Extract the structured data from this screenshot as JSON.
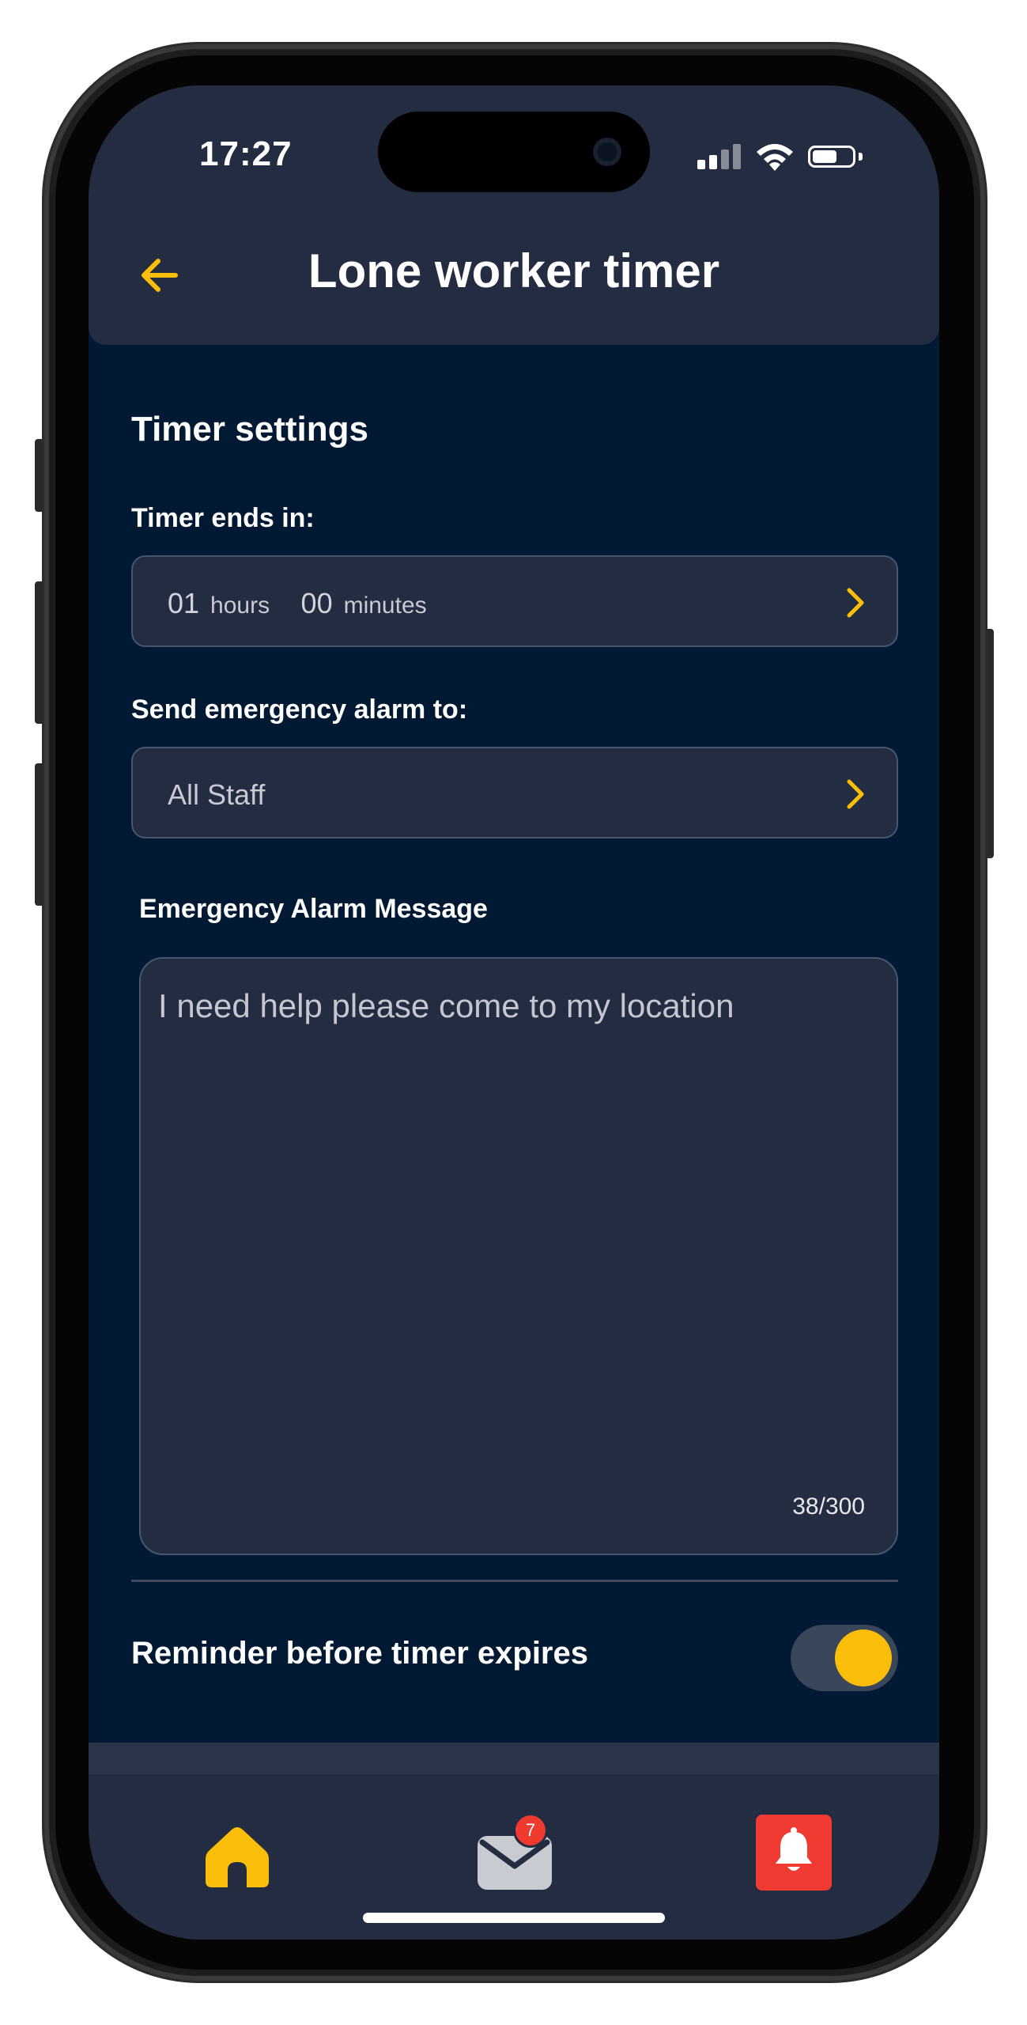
{
  "status_bar": {
    "time": "17:27"
  },
  "header": {
    "title": "Lone worker timer"
  },
  "settings": {
    "section_title": "Timer settings",
    "timer": {
      "label": "Timer ends in:",
      "hours_value": "01",
      "hours_unit": "hours",
      "minutes_value": "00",
      "minutes_unit": "minutes"
    },
    "recipient": {
      "label": "Send emergency alarm to:",
      "value": "All Staff"
    },
    "message": {
      "label": "Emergency Alarm Message",
      "text": "I need help please come to my location",
      "count": "38/300"
    },
    "reminder": {
      "label": "Reminder before timer expires",
      "enabled": true
    }
  },
  "nav": {
    "mail_badge": "7"
  },
  "colors": {
    "accent": "#fbbf0b",
    "background": "#011933",
    "surface": "#232c40",
    "alarm": "#ef3b31"
  },
  "icons": [
    "back-arrow-icon",
    "chevron-right-icon",
    "home-icon",
    "mail-icon",
    "bell-icon",
    "signal-icon",
    "wifi-icon",
    "battery-icon"
  ]
}
